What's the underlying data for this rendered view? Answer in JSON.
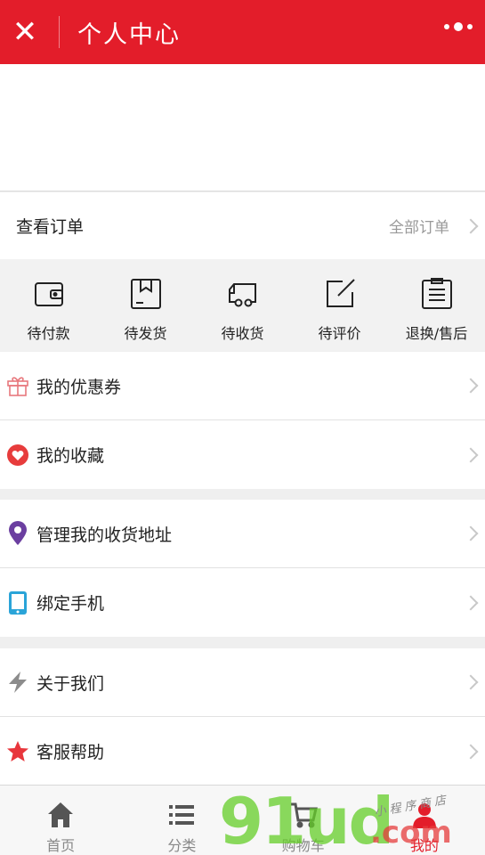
{
  "header": {
    "title": "个人中心",
    "close_icon": "close-icon",
    "more_icon": "more-dots-icon",
    "color": "#e31d2a"
  },
  "orders": {
    "label": "查看订单",
    "all_label": "全部订单",
    "tabs": [
      {
        "label": "待付款",
        "icon": "wallet-icon"
      },
      {
        "label": "待发货",
        "icon": "package-icon"
      },
      {
        "label": "待收货",
        "icon": "truck-icon"
      },
      {
        "label": "待评价",
        "icon": "edit-icon"
      },
      {
        "label": "退换/售后",
        "icon": "list-icon"
      }
    ]
  },
  "menu": [
    {
      "label": "我的优惠券",
      "icon": "gift-icon"
    },
    {
      "label": "我的收藏",
      "icon": "heart-icon"
    },
    {
      "label": "管理我的收货地址",
      "icon": "location-pin-icon"
    },
    {
      "label": "绑定手机",
      "icon": "tablet-icon"
    },
    {
      "label": "关于我们",
      "icon": "lightning-icon"
    },
    {
      "label": "客服帮助",
      "icon": "star-icon"
    }
  ],
  "tabbar": [
    {
      "label": "首页",
      "icon": "home-icon"
    },
    {
      "label": "分类",
      "icon": "category-list-icon"
    },
    {
      "label": "购物车",
      "icon": "cart-icon"
    },
    {
      "label": "我的",
      "icon": "user-icon",
      "active": true
    }
  ],
  "watermark": {
    "main": "91ud",
    "suffix": ".com",
    "note": "小程序商店"
  }
}
